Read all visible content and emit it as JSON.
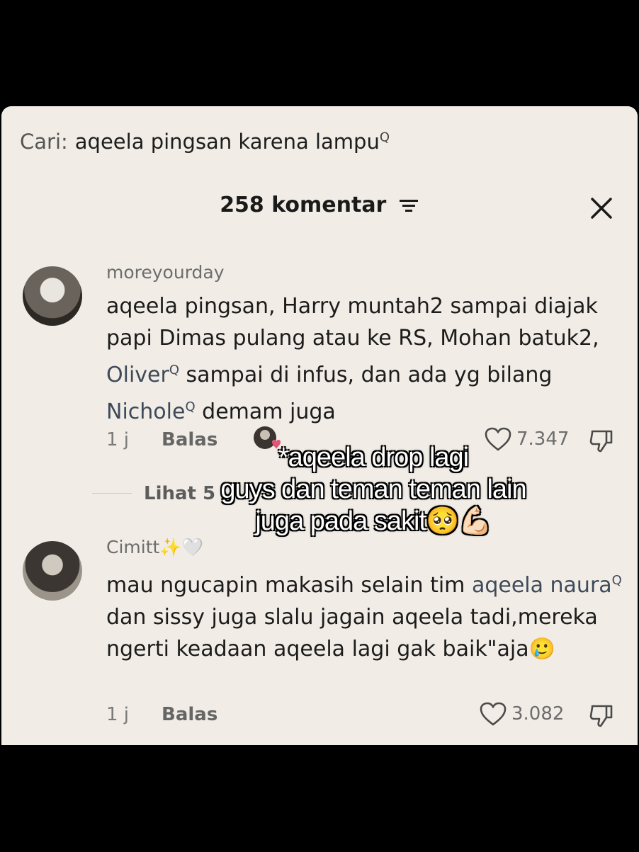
{
  "search": {
    "label": "Cari:",
    "query": "aqeela pingsan karena lampu",
    "search_marker": "Q"
  },
  "header": {
    "title": "258 komentar",
    "filter_icon": "filter-icon",
    "close_icon": "close-icon"
  },
  "comments": [
    {
      "username": "moreyourday",
      "text_parts": [
        "aqeela pingsan, Harry muntah2 sampai diajak papi Dimas pulang atau ke RS, Mohan batuk2, ",
        "Oliver",
        " sampai di infus, dan ada yg bilang ",
        "Nichole",
        " demam juga"
      ],
      "time": "1 j",
      "reply": "Balas",
      "likes": "7.347"
    },
    {
      "username": "Cimitt✨🤍",
      "text_parts": [
        "mau ngucapin makasih selain tim ",
        "aqeela naura",
        " dan sissy juga slalu jagain aqeela tadi,mereka ngerti keadaan aqeela lagi gak baik\"aja🥲"
      ],
      "time": "1 j",
      "reply": "Balas",
      "likes": "3.082"
    }
  ],
  "view_replies": "Lihat 5",
  "overlay": {
    "line1": "*aqeela drop lagi",
    "line2": "guys dan teman teman lain",
    "line3": "juga pada sakit🥺💪🏻"
  },
  "colors": {
    "panel_bg": "#f1ede6",
    "mention": "#3e4a5a",
    "text": "#1c1c1c"
  }
}
